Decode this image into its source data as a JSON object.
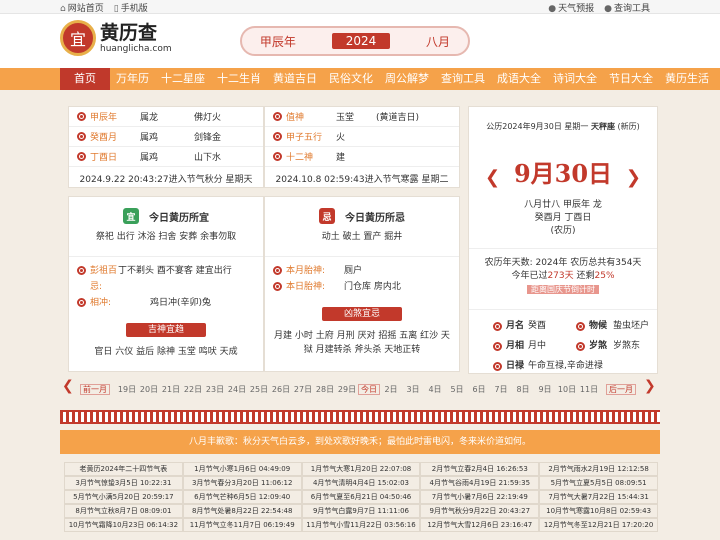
{
  "topbar": {
    "home": "网站首页",
    "mobile": "手机版",
    "weather": "天气预报",
    "tools": "查询工具"
  },
  "logo": {
    "seal": "宜",
    "cn": "黄历查",
    "en": "huanglicha.com"
  },
  "banner": {
    "ganzhi_year": "甲辰年",
    "year": "2024",
    "month": "八月"
  },
  "nav": [
    "首页",
    "万年历",
    "十二星座",
    "十二生肖",
    "黄道吉日",
    "民俗文化",
    "周公解梦",
    "查询工具",
    "成语大全",
    "诗词大全",
    "节日大全",
    "黄历生活"
  ],
  "left_info": {
    "rows": [
      [
        "甲辰年",
        "属龙",
        "佛灯火"
      ],
      [
        "癸酉月",
        "属鸡",
        "剑锋金"
      ],
      [
        "丁酉日",
        "属鸡",
        "山下水"
      ]
    ],
    "note": "2024.9.22 20:43:27进入节气秋分 星期天"
  },
  "mid_info": {
    "rows": [
      [
        "值神",
        "玉堂",
        "(黄道吉日)"
      ],
      [
        "甲子五行",
        "火",
        ""
      ],
      [
        "十二神",
        "建",
        ""
      ]
    ],
    "note": "2024.10.8 02:59:43进入节气寒露 星期二"
  },
  "yi": {
    "seal": "宜",
    "title": "今日黄历所宜",
    "items": "祭祀 出行 沐浴 扫舍 安葬 余事勿取",
    "pengzu_label": "彭祖百忌:",
    "pengzu": "丁不剃头  酉不宴客  建宜出行",
    "xiangchong_label": "相冲:",
    "xiangchong": "鸡日冲(辛卯)兔",
    "shen_title": "吉神宜趋",
    "shen": "官日 六仪 益后 除神 玉堂 鸣吠 天成"
  },
  "ji": {
    "seal": "忌",
    "title": "今日黄历所忌",
    "items": "动土  破土  置产  掘井",
    "taishen_label": "本月胎神:",
    "taishen": "厕户",
    "ritaishen_label": "本日胎神:",
    "ritaishen": "门仓库  房内北",
    "sha_title": "凶煞宜忌",
    "sha": "月建 小时 土府 月刑 厌对 招摇 五离 红沙 天狱 月建转杀 斧头杀 天地正转"
  },
  "calendar": {
    "header_prefix": "公历2024年9月30日 星期一",
    "constellation": "天秤座",
    "header_suffix": "(新历)",
    "big_date": "9月30日",
    "lunar": "八月廿八 甲辰年 龙",
    "ganzhi": "癸酉月 丁酉日",
    "lunar_tag": "(农历)",
    "days_line": "农历年天数: 2024年 农历总共有354天",
    "passed_prefix": "今年已过",
    "passed": "273天",
    "remain_prefix": "还剩",
    "remain": "25%",
    "countdown": "距离国庆节倒计时",
    "items": [
      [
        "月名",
        "癸酉",
        "物候",
        "蛰虫坯户"
      ],
      [
        "月相",
        "月中",
        "岁煞",
        "岁煞东"
      ],
      [
        "日禄",
        "午命互禄,辛命进禄",
        "",
        ""
      ]
    ]
  },
  "strip": {
    "prev": "前一月",
    "next": "后一月",
    "today": "今日",
    "days_before": [
      "19日",
      "20日",
      "21日",
      "22日",
      "23日",
      "24日",
      "25日",
      "26日",
      "27日",
      "28日",
      "29日"
    ],
    "days_after": [
      "2日",
      "3日",
      "4日",
      "5日",
      "6日",
      "7日",
      "8日",
      "9日",
      "10日",
      "11日"
    ]
  },
  "notice": "八月丰歉歌：秋分天气白云多，到处欢歌好晚禾；最怕此时雷电闪，冬来米价道如何。",
  "terms": [
    "老黄历2024年二十四节气表",
    "1月节气小寒1月6日 04:49:09",
    "1月节气大寒1月20日 22:07:08",
    "2月节气立春2月4日 16:26:53",
    "2月节气雨水2月19日 12:12:58",
    "3月节气惊蛰3月5日 10:22:31",
    "3月节气春分3月20日 11:06:12",
    "4月节气清明4月4日 15:02:03",
    "4月节气谷雨4月19日 21:59:35",
    "5月节气立夏5月5日 08:09:51",
    "5月节气小满5月20日 20:59:17",
    "6月节气芒种6月5日 12:09:40",
    "6月节气夏至6月21日 04:50:46",
    "7月节气小暑7月6日 22:19:49",
    "7月节气大暑7月22日 15:44:31",
    "8月节气立秋8月7日 08:09:01",
    "8月节气处暑8月22日 22:54:48",
    "9月节气白露9月7日 11:11:06",
    "9月节气秋分9月22日 20:43:27",
    "10月节气寒露10月8日 02:59:43",
    "10月节气霜降10月23日 06:14:32",
    "11月节气立冬11月7日 06:19:49",
    "11月节气小雪11月22日 03:56:16",
    "12月节气大雪12月6日 23:16:47",
    "12月节气冬至12月21日 17:20:20"
  ],
  "colors": {
    "brand": "#c2392b",
    "nav": "#f5a24a",
    "label": "#e07a2e"
  }
}
